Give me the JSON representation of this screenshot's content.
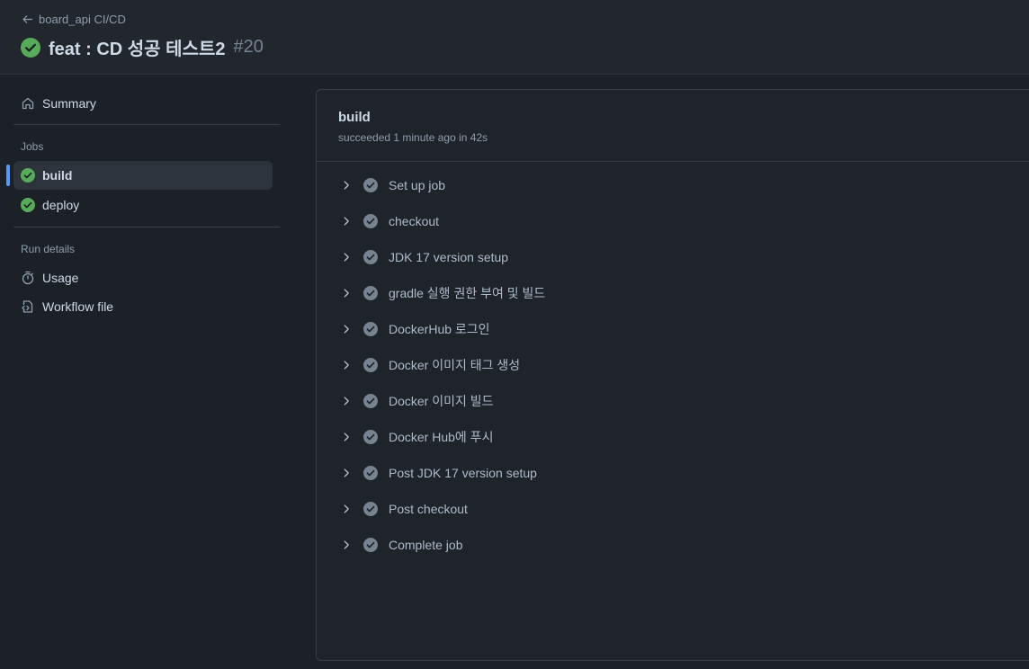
{
  "header": {
    "back_label": "board_api CI/CD",
    "title": "feat : CD 성공 테스트2",
    "run_number": "#20"
  },
  "sidebar": {
    "summary_label": "Summary",
    "jobs_heading": "Jobs",
    "jobs": [
      {
        "label": "build",
        "status": "success",
        "active": true
      },
      {
        "label": "deploy",
        "status": "success",
        "active": false
      }
    ],
    "run_details_heading": "Run details",
    "usage_label": "Usage",
    "workflow_file_label": "Workflow file"
  },
  "job": {
    "name": "build",
    "meta": "succeeded 1 minute ago in 42s",
    "steps": [
      "Set up job",
      "checkout",
      "JDK 17 version setup",
      "gradle 실행 권한 부여 및 빌드",
      "DockerHub 로그인",
      "Docker 이미지 태그 생성",
      "Docker 이미지 빌드",
      "Docker Hub에 푸시",
      "Post JDK 17 version setup",
      "Post checkout",
      "Complete job"
    ]
  },
  "colors": {
    "success": "#57ab5a",
    "accent": "#539bf5",
    "step_check": "#768390"
  },
  "icons": {
    "back": "arrow-left-icon",
    "status": "check-circle-fill-icon",
    "summary": "home-icon",
    "usage": "stopwatch-icon",
    "workflow": "file-code-icon",
    "step_expand": "chevron-right-icon"
  }
}
